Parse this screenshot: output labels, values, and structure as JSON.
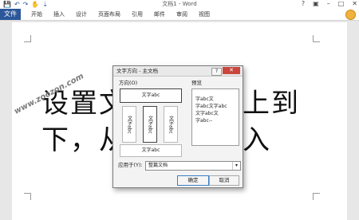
{
  "titlebar": {
    "title": "文档1 - Word",
    "qat_icons": [
      "save-icon",
      "undo-icon",
      "redo-icon",
      "touch-mode-icon",
      "customize-icon"
    ],
    "qat_glyphs": [
      "💾",
      "↶",
      "↷",
      "✋",
      "⇣"
    ],
    "window_glyphs": [
      "?",
      "▣",
      "–",
      "□",
      "✕"
    ]
  },
  "ribbon": {
    "file_tab": "文件",
    "tabs": [
      "开始",
      "插入",
      "设计",
      "页面布局",
      "引用",
      "邮件",
      "审阅",
      "视图"
    ]
  },
  "document": {
    "text": "设置文字方向从上到\n下，从右往左输入",
    "watermark": "www.zoozon.com"
  },
  "dialog": {
    "title": "文字方向 - 主文档",
    "help": "?",
    "close": "✕",
    "orientation_label": "方向(O)",
    "orientation_options": [
      "文字abc",
      "文字abc",
      "文字abc",
      "文字abc",
      "文字abc"
    ],
    "preview_label": "预览",
    "preview_lines": [
      "字abc文",
      "字abc文字abc",
      "文字abc文",
      "字abc--"
    ],
    "apply_label": "应用于(Y):",
    "apply_value": "整篇文档",
    "ok": "确定",
    "cancel": "取消"
  }
}
